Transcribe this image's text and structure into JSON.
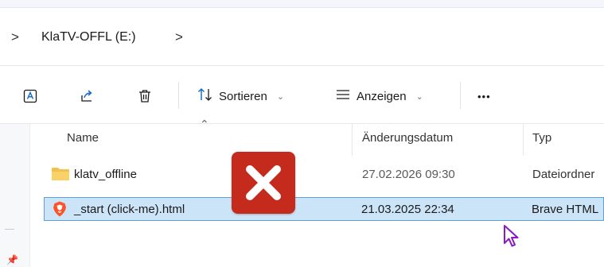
{
  "breadcrumb": {
    "expand_glyph": ">",
    "drive_label": "KlaTV-OFFL (E:)",
    "next_glyph": ">"
  },
  "toolbar": {
    "sort_label": "Sortieren",
    "view_label": "Anzeigen",
    "more_label": "•••",
    "icons": [
      "rename-icon",
      "share-icon",
      "delete-icon",
      "sort-icon",
      "view-icon"
    ]
  },
  "columns": {
    "name": "Name",
    "modified": "Änderungsdatum",
    "type": "Typ"
  },
  "files": [
    {
      "name": "klatv_offline",
      "modified": "27.02.2026 09:30",
      "type": "Dateiordner",
      "icon": "folder-icon",
      "selected": false
    },
    {
      "name": "_start (click-me).html",
      "modified": "21.03.2025 22:34",
      "type": "Brave HTML",
      "icon": "brave-html-icon",
      "selected": true
    }
  ],
  "overlay": {
    "icon": "error-x-icon",
    "color": "#c42b1c"
  },
  "colors": {
    "selection_bg": "#cce4f7",
    "selection_border": "#5ea0d6",
    "folder": "#f2c14b",
    "brave": "#fb542b",
    "cursor": "#8a18c9"
  }
}
